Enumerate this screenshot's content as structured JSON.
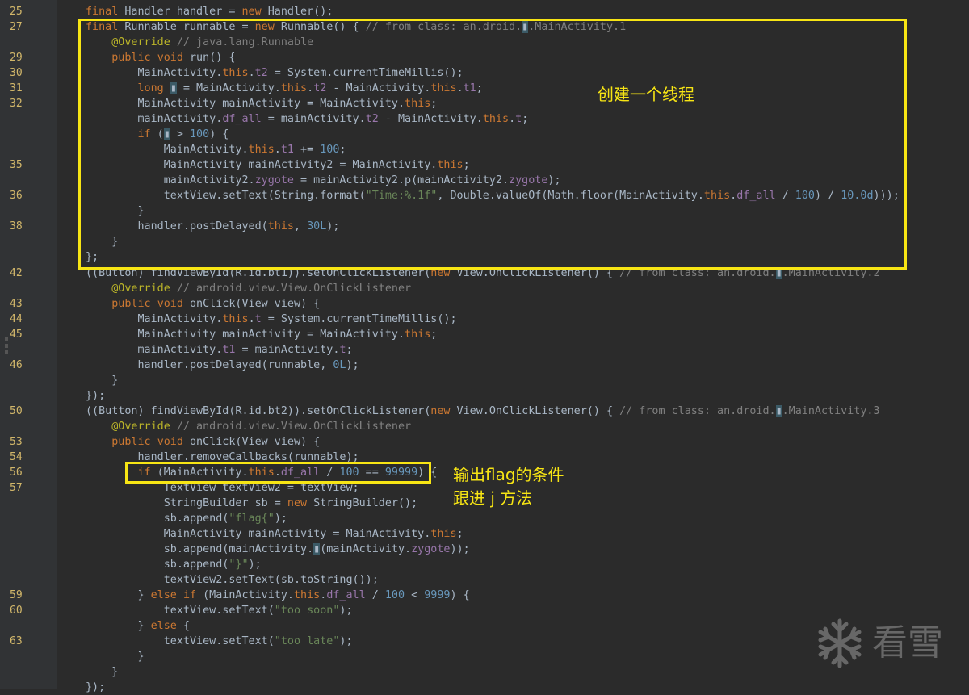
{
  "editor": {
    "lines": [
      {
        "num": "25",
        "code": "final Handler handler = new Handler();"
      },
      {
        "num": "27",
        "code": "final Runnable runnable = new Runnable() { // from class: an.droid.▮.MainActivity.1"
      },
      {
        "num": "",
        "code": "    @Override // java.lang.Runnable"
      },
      {
        "num": "29",
        "code": "    public void run() {"
      },
      {
        "num": "30",
        "code": "        MainActivity.this.t2 = System.currentTimeMillis();"
      },
      {
        "num": "31",
        "code": "        long ▮ = MainActivity.this.t2 - MainActivity.this.t1;"
      },
      {
        "num": "32",
        "code": "        MainActivity mainActivity = MainActivity.this;"
      },
      {
        "num": "",
        "code": "        mainActivity.df_all = mainActivity.t2 - MainActivity.this.t;"
      },
      {
        "num": "",
        "code": "        if (▮ > 100) {"
      },
      {
        "num": "",
        "code": "            MainActivity.this.t1 += 100;"
      },
      {
        "num": "35",
        "code": "            MainActivity mainActivity2 = MainActivity.this;"
      },
      {
        "num": "",
        "code": "            mainActivity2.zygote = mainActivity2.p(mainActivity2.zygote);"
      },
      {
        "num": "36",
        "code": "            textView.setText(String.format(\"Time:%.1f\", Double.valueOf(Math.floor(MainActivity.this.df_all / 100) / 10.0d)));"
      },
      {
        "num": "",
        "code": "        }"
      },
      {
        "num": "38",
        "code": "        handler.postDelayed(this, 30L);"
      },
      {
        "num": "",
        "code": "    }"
      },
      {
        "num": "",
        "code": "};"
      },
      {
        "num": "42",
        "code": "((Button) findViewById(R.id.bt1)).setOnClickListener(new View.OnClickListener() { // from class: an.droid.▮.MainActivity.2"
      },
      {
        "num": "",
        "code": "    @Override // android.view.View.OnClickListener"
      },
      {
        "num": "43",
        "code": "    public void onClick(View view) {"
      },
      {
        "num": "44",
        "code": "        MainActivity.this.t = System.currentTimeMillis();"
      },
      {
        "num": "45",
        "code": "        MainActivity mainActivity = MainActivity.this;"
      },
      {
        "num": "",
        "code": "        mainActivity.t1 = mainActivity.t;"
      },
      {
        "num": "46",
        "code": "        handler.postDelayed(runnable, 0L);"
      },
      {
        "num": "",
        "code": "    }"
      },
      {
        "num": "",
        "code": "});"
      },
      {
        "num": "50",
        "code": "((Button) findViewById(R.id.bt2)).setOnClickListener(new View.OnClickListener() { // from class: an.droid.▮.MainActivity.3"
      },
      {
        "num": "",
        "code": "    @Override // android.view.View.OnClickListener"
      },
      {
        "num": "53",
        "code": "    public void onClick(View view) {"
      },
      {
        "num": "54",
        "code": "        handler.removeCallbacks(runnable);"
      },
      {
        "num": "56",
        "code": "        if (MainActivity.this.df_all / 100 == 99999) {"
      },
      {
        "num": "57",
        "code": "            TextView textView2 = textView;"
      },
      {
        "num": "",
        "code": "            StringBuilder sb = new StringBuilder();"
      },
      {
        "num": "",
        "code": "            sb.append(\"flag{\");"
      },
      {
        "num": "",
        "code": "            MainActivity mainActivity = MainActivity.this;"
      },
      {
        "num": "",
        "code": "            sb.append(mainActivity.▮(mainActivity.zygote));"
      },
      {
        "num": "",
        "code": "            sb.append(\"}\");"
      },
      {
        "num": "",
        "code": "            textView2.setText(sb.toString());"
      },
      {
        "num": "59",
        "code": "        } else if (MainActivity.this.df_all / 100 < 9999) {"
      },
      {
        "num": "60",
        "code": "            textView.setText(\"too soon\");"
      },
      {
        "num": "",
        "code": "        } else {"
      },
      {
        "num": "63",
        "code": "            textView.setText(\"too late\");"
      },
      {
        "num": "",
        "code": "        }"
      },
      {
        "num": "",
        "code": "    }"
      },
      {
        "num": "",
        "code": "});"
      }
    ]
  },
  "annotations": {
    "thread_note": "创建一个线程",
    "flag_note_line1": "输出flag的条件",
    "flag_note_line2": "跟进 j 方法"
  },
  "watermark": {
    "text": "看雪",
    "icon": "snowflake-icon"
  },
  "colors": {
    "highlight_box": "#f7e514",
    "background": "#2b2b2b"
  }
}
